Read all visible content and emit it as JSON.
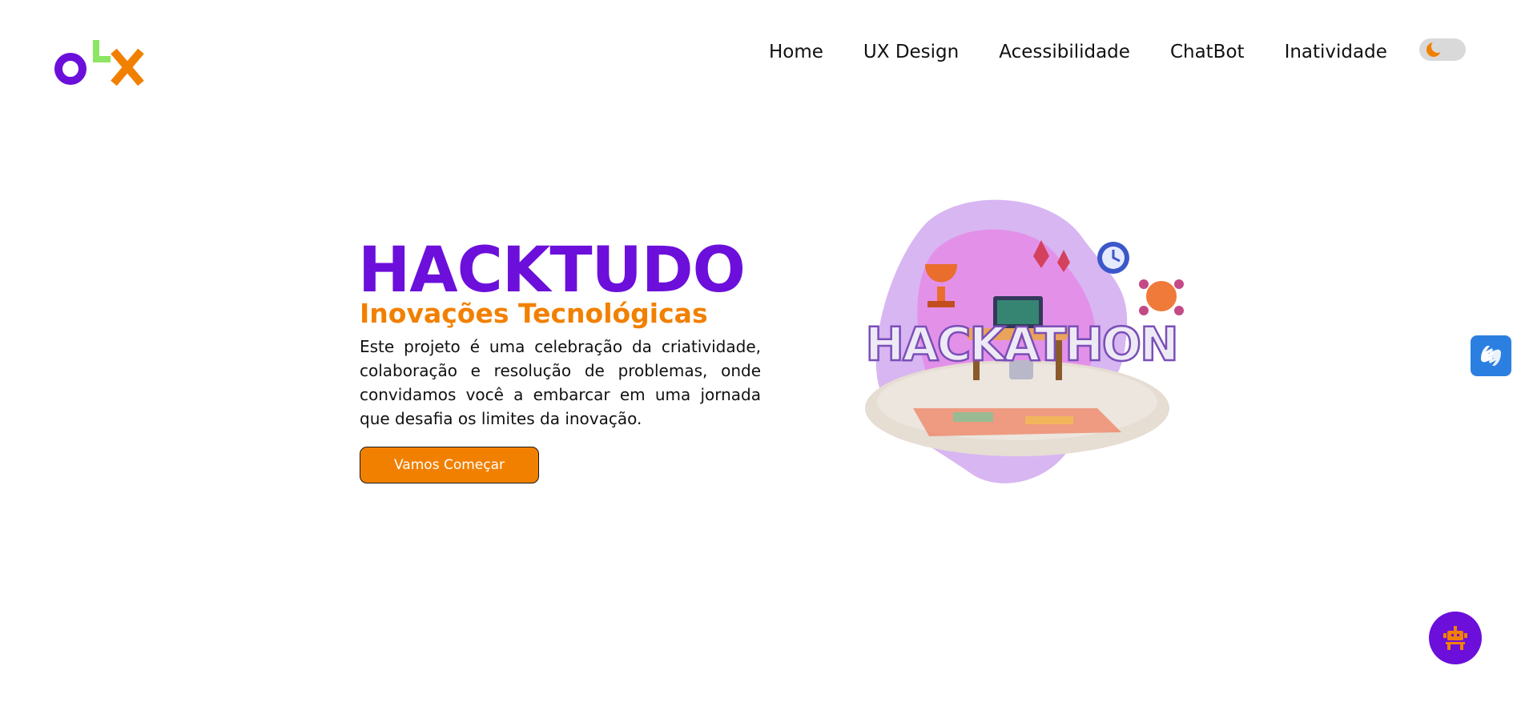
{
  "brand": {
    "logo_text": "OLX",
    "colors": {
      "purple": "#6c0fdb",
      "green": "#8ce563",
      "orange": "#f28000"
    }
  },
  "nav": {
    "items": [
      {
        "label": "Home"
      },
      {
        "label": "UX Design"
      },
      {
        "label": "Acessibilidade"
      },
      {
        "label": "ChatBot"
      },
      {
        "label": "Inatividade"
      }
    ],
    "theme_toggle": {
      "icon": "moon-icon",
      "state": "light"
    }
  },
  "hero": {
    "title": "HACKTUDO",
    "subtitle": "Inovações Tecnológicas",
    "description": "Este projeto é uma celebração da criatividade, colaboração e resolução de problemas, onde convidamos você a embarcar em uma jornada que desafia os limites da inovação.",
    "cta_label": "Vamos Começar",
    "illustration_text": "HACKATHON"
  },
  "widgets": {
    "accessibility_icon": "sign-language-hands-icon",
    "chatbot_icon": "robot-icon"
  }
}
